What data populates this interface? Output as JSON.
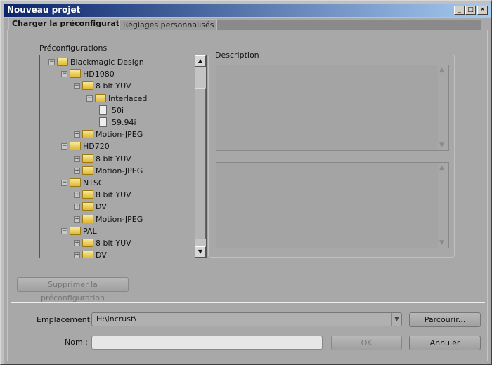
{
  "window": {
    "title": "Nouveau projet"
  },
  "tabs": [
    {
      "label": "Charger la préconfiguration",
      "active": true
    },
    {
      "label": "Réglages personnalisés",
      "active": false
    }
  ],
  "presets": {
    "label": "Préconfigurations",
    "items": [
      {
        "label": "Blackmagic Design",
        "level": 0,
        "type": "folder",
        "state": "expanded"
      },
      {
        "label": "HD1080",
        "level": 1,
        "type": "folder",
        "state": "expanded"
      },
      {
        "label": "8 bit YUV",
        "level": 2,
        "type": "folder",
        "state": "expanded"
      },
      {
        "label": "Interlaced",
        "level": 3,
        "type": "folder",
        "state": "expanded"
      },
      {
        "label": "50i",
        "level": 4,
        "type": "file"
      },
      {
        "label": "59.94i",
        "level": 4,
        "type": "file"
      },
      {
        "label": "Motion-JPEG",
        "level": 2,
        "type": "folder",
        "state": "collapsed"
      },
      {
        "label": "HD720",
        "level": 1,
        "type": "folder",
        "state": "expanded"
      },
      {
        "label": "8 bit YUV",
        "level": 2,
        "type": "folder",
        "state": "collapsed"
      },
      {
        "label": "Motion-JPEG",
        "level": 2,
        "type": "folder",
        "state": "collapsed"
      },
      {
        "label": "NTSC",
        "level": 1,
        "type": "folder",
        "state": "expanded"
      },
      {
        "label": "8 bit YUV",
        "level": 2,
        "type": "folder",
        "state": "collapsed"
      },
      {
        "label": "DV",
        "level": 2,
        "type": "folder",
        "state": "collapsed"
      },
      {
        "label": "Motion-JPEG",
        "level": 2,
        "type": "folder",
        "state": "collapsed"
      },
      {
        "label": "PAL",
        "level": 1,
        "type": "folder",
        "state": "expanded"
      },
      {
        "label": "8 bit YUV",
        "level": 2,
        "type": "folder",
        "state": "collapsed"
      },
      {
        "label": "DV",
        "level": 2,
        "type": "folder",
        "state": "collapsed"
      }
    ]
  },
  "description": {
    "label": "Description"
  },
  "buttons": {
    "delete": "Supprimer la préconfiguration",
    "browse": "Parcourir...",
    "ok": "OK",
    "cancel": "Annuler"
  },
  "location": {
    "label": "Emplacement :",
    "value": "H:\\incrust\\"
  },
  "name": {
    "label": "Nom :",
    "value": ""
  }
}
